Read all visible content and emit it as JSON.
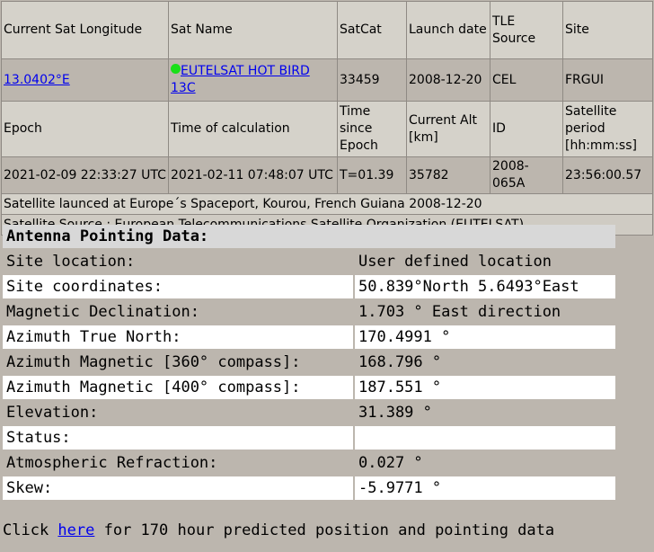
{
  "sat_table": {
    "headers1": [
      "Current Sat Longitude",
      "Sat Name",
      "SatCat",
      "Launch date",
      "TLE Source",
      "Site"
    ],
    "row1": {
      "longitude": "13.0402°E",
      "sat_name": "EUTELSAT HOT BIRD 13C",
      "satcat": "33459",
      "launch_date": "2008-12-20",
      "tle_source": "CEL",
      "site": "FRGUI"
    },
    "headers2": [
      "Epoch",
      "Time of calculation",
      "Time since Epoch",
      "Current Alt [km]",
      "ID",
      "Satellite period [hh:mm:ss]"
    ],
    "row2": {
      "epoch": "2021-02-09 22:33:27 UTC",
      "time_calc": "2021-02-11 07:48:07 UTC",
      "time_since": "T=01.39",
      "alt": "35782",
      "id": "2008-065A",
      "period": "23:56:00.57"
    },
    "launch_note": "Satellite launced at Europe´s Spaceport, Kourou, French Guiana 2008-12-20",
    "source_note": "Satellite Source : European Telecommunications Satellite Organization (EUTELSAT)",
    "status_color": "#19e019"
  },
  "antenna": {
    "title": "Antenna Pointing Data:",
    "rows": [
      {
        "label": "Site location:",
        "value": "User defined location"
      },
      {
        "label": "Site coordinates:",
        "value": "50.839°North 5.6493°East"
      },
      {
        "label": "Magnetic Declination:",
        "value": "1.703 ° East direction"
      },
      {
        "label": "Azimuth True North:",
        "value": "170.4991 °"
      },
      {
        "label": "Azimuth Magnetic [360° compass]:",
        "value": "168.796 °"
      },
      {
        "label": "Azimuth Magnetic [400° compass]:",
        "value": "187.551 °"
      },
      {
        "label": "Elevation:",
        "value": "31.389 °"
      },
      {
        "label": "Status:",
        "value": ""
      },
      {
        "label": "Atmospheric Refraction:",
        "value": "0.027 °"
      },
      {
        "label": "Skew:",
        "value": "-5.9771 °"
      }
    ]
  },
  "footer": {
    "prefix": "Click ",
    "link": "here",
    "suffix": " for 170 hour predicted position and pointing data"
  }
}
